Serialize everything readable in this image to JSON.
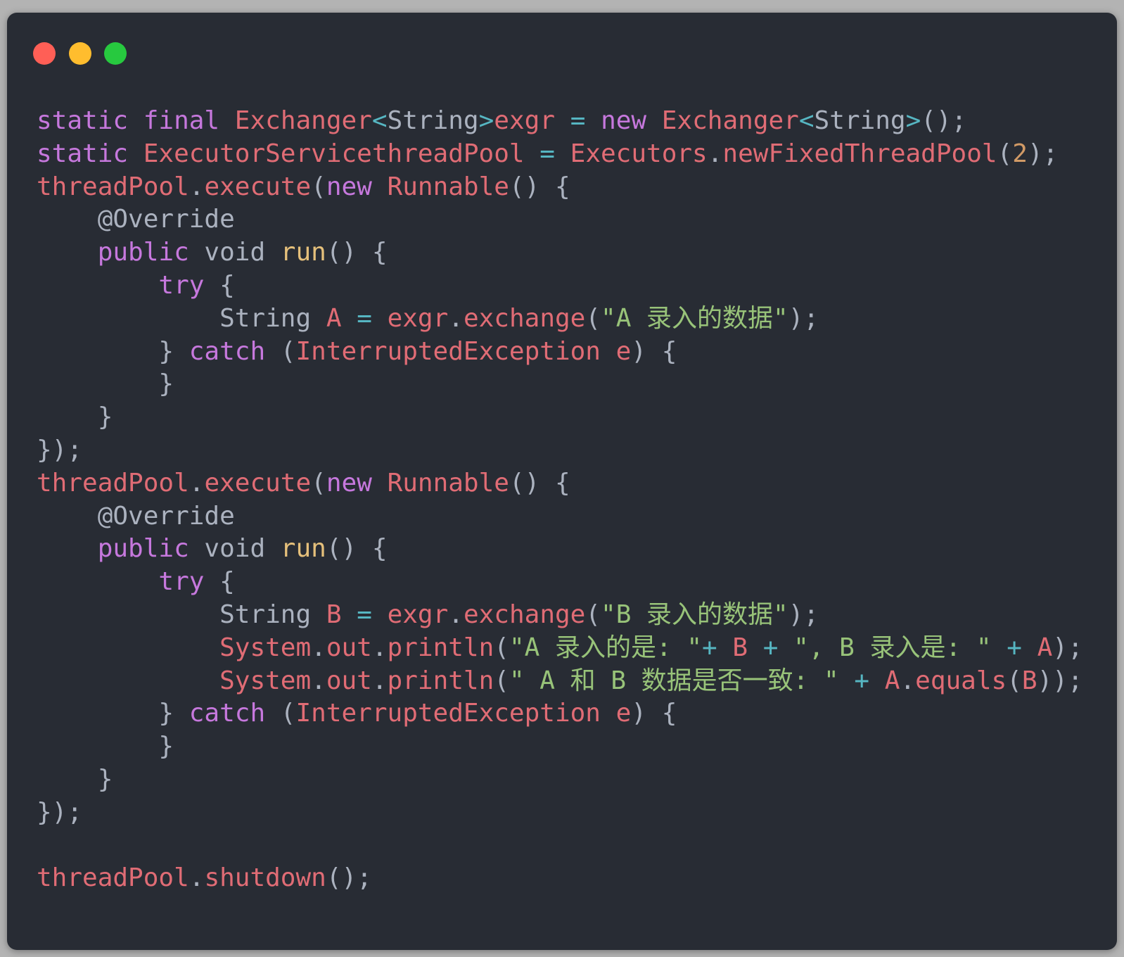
{
  "window": {
    "controls": [
      "close",
      "minimize",
      "maximize"
    ],
    "colors": {
      "background": "#282c34",
      "close": "#ff5f56",
      "minimize": "#ffbd2e",
      "maximize": "#27c93f"
    }
  },
  "code_lines": [
    [
      [
        "k",
        "static"
      ],
      [
        "p",
        " "
      ],
      [
        "k",
        "final"
      ],
      [
        "p",
        " "
      ],
      [
        "t",
        "Exchanger"
      ],
      [
        "o",
        "<"
      ],
      [
        "p",
        "String"
      ],
      [
        "o",
        ">"
      ],
      [
        "t",
        "exgr"
      ],
      [
        "p",
        " "
      ],
      [
        "o",
        "="
      ],
      [
        "p",
        " "
      ],
      [
        "k",
        "new"
      ],
      [
        "p",
        " "
      ],
      [
        "t",
        "Exchanger"
      ],
      [
        "o",
        "<"
      ],
      [
        "p",
        "String"
      ],
      [
        "o",
        ">"
      ],
      [
        "p",
        "();"
      ]
    ],
    [
      [
        "k",
        "static"
      ],
      [
        "p",
        " "
      ],
      [
        "t",
        "ExecutorServicethreadPool"
      ],
      [
        "p",
        " "
      ],
      [
        "o",
        "="
      ],
      [
        "p",
        " "
      ],
      [
        "t",
        "Executors"
      ],
      [
        "p",
        "."
      ],
      [
        "t",
        "newFixedThreadPool"
      ],
      [
        "p",
        "("
      ],
      [
        "n",
        "2"
      ],
      [
        "p",
        ");"
      ]
    ],
    [
      [
        "t",
        "threadPool"
      ],
      [
        "p",
        "."
      ],
      [
        "t",
        "execute"
      ],
      [
        "p",
        "("
      ],
      [
        "k",
        "new"
      ],
      [
        "p",
        " "
      ],
      [
        "t",
        "Runnable"
      ],
      [
        "p",
        "() {"
      ]
    ],
    [
      [
        "p",
        "    @Override"
      ]
    ],
    [
      [
        "p",
        "    "
      ],
      [
        "k",
        "public"
      ],
      [
        "p",
        " void "
      ],
      [
        "f",
        "run"
      ],
      [
        "p",
        "() {"
      ]
    ],
    [
      [
        "p",
        "        "
      ],
      [
        "k",
        "try"
      ],
      [
        "p",
        " {"
      ]
    ],
    [
      [
        "p",
        "            String "
      ],
      [
        "t",
        "A"
      ],
      [
        "p",
        " "
      ],
      [
        "o",
        "="
      ],
      [
        "p",
        " "
      ],
      [
        "t",
        "exgr"
      ],
      [
        "p",
        "."
      ],
      [
        "t",
        "exchange"
      ],
      [
        "p",
        "("
      ],
      [
        "s",
        "\"A 录入的数据\""
      ],
      [
        "p",
        ");"
      ]
    ],
    [
      [
        "p",
        "        } "
      ],
      [
        "k",
        "catch"
      ],
      [
        "p",
        " ("
      ],
      [
        "t",
        "InterruptedException"
      ],
      [
        "p",
        " "
      ],
      [
        "t",
        "e"
      ],
      [
        "p",
        ") {"
      ]
    ],
    [
      [
        "p",
        "        }"
      ]
    ],
    [
      [
        "p",
        "    }"
      ]
    ],
    [
      [
        "p",
        "});"
      ]
    ],
    [
      [
        "t",
        "threadPool"
      ],
      [
        "p",
        "."
      ],
      [
        "t",
        "execute"
      ],
      [
        "p",
        "("
      ],
      [
        "k",
        "new"
      ],
      [
        "p",
        " "
      ],
      [
        "t",
        "Runnable"
      ],
      [
        "p",
        "() {"
      ]
    ],
    [
      [
        "p",
        "    @Override"
      ]
    ],
    [
      [
        "p",
        "    "
      ],
      [
        "k",
        "public"
      ],
      [
        "p",
        " void "
      ],
      [
        "f",
        "run"
      ],
      [
        "p",
        "() {"
      ]
    ],
    [
      [
        "p",
        "        "
      ],
      [
        "k",
        "try"
      ],
      [
        "p",
        " {"
      ]
    ],
    [
      [
        "p",
        "            String "
      ],
      [
        "t",
        "B"
      ],
      [
        "p",
        " "
      ],
      [
        "o",
        "="
      ],
      [
        "p",
        " "
      ],
      [
        "t",
        "exgr"
      ],
      [
        "p",
        "."
      ],
      [
        "t",
        "exchange"
      ],
      [
        "p",
        "("
      ],
      [
        "s",
        "\"B 录入的数据\""
      ],
      [
        "p",
        ");"
      ]
    ],
    [
      [
        "p",
        "            "
      ],
      [
        "t",
        "System"
      ],
      [
        "p",
        "."
      ],
      [
        "t",
        "out"
      ],
      [
        "p",
        "."
      ],
      [
        "t",
        "println"
      ],
      [
        "p",
        "("
      ],
      [
        "s",
        "\"A 录入的是: \""
      ],
      [
        "o",
        "+"
      ],
      [
        "p",
        " "
      ],
      [
        "t",
        "B"
      ],
      [
        "p",
        " "
      ],
      [
        "o",
        "+"
      ],
      [
        "p",
        " "
      ],
      [
        "s",
        "\", B 录入是: \""
      ],
      [
        "p",
        " "
      ],
      [
        "o",
        "+"
      ],
      [
        "p",
        " "
      ],
      [
        "t",
        "A"
      ],
      [
        "p",
        ");"
      ]
    ],
    [
      [
        "p",
        "            "
      ],
      [
        "t",
        "System"
      ],
      [
        "p",
        "."
      ],
      [
        "t",
        "out"
      ],
      [
        "p",
        "."
      ],
      [
        "t",
        "println"
      ],
      [
        "p",
        "("
      ],
      [
        "s",
        "\" A 和 B 数据是否一致: \""
      ],
      [
        "p",
        " "
      ],
      [
        "o",
        "+"
      ],
      [
        "p",
        " "
      ],
      [
        "t",
        "A"
      ],
      [
        "p",
        "."
      ],
      [
        "t",
        "equals"
      ],
      [
        "p",
        "("
      ],
      [
        "t",
        "B"
      ],
      [
        "p",
        "));"
      ]
    ],
    [
      [
        "p",
        "        } "
      ],
      [
        "k",
        "catch"
      ],
      [
        "p",
        " ("
      ],
      [
        "t",
        "InterruptedException"
      ],
      [
        "p",
        " "
      ],
      [
        "t",
        "e"
      ],
      [
        "p",
        ") {"
      ]
    ],
    [
      [
        "p",
        "        }"
      ]
    ],
    [
      [
        "p",
        "    }"
      ]
    ],
    [
      [
        "p",
        "});"
      ]
    ],
    [],
    [
      [
        "t",
        "threadPool"
      ],
      [
        "p",
        "."
      ],
      [
        "t",
        "shutdown"
      ],
      [
        "p",
        "();"
      ]
    ]
  ]
}
